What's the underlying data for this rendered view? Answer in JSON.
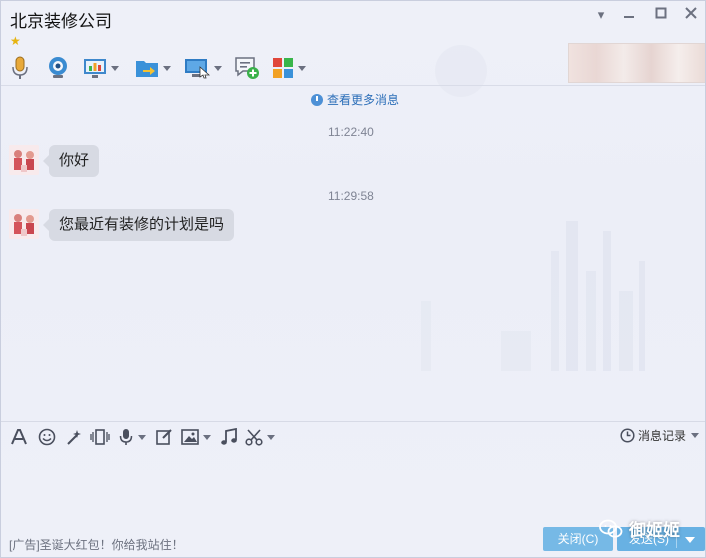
{
  "window": {
    "title": "北京装修公司",
    "favorite_icon": "star-icon",
    "controls": [
      "dropdown-icon",
      "minimize-icon",
      "maximize-icon",
      "close-icon"
    ]
  },
  "toolbar": {
    "items": [
      {
        "name": "voice-call",
        "icon": "microphone-icon"
      },
      {
        "name": "video-call",
        "icon": "webcam-icon"
      },
      {
        "name": "remote-desktop",
        "icon": "presentation-icon",
        "dropdown": true
      },
      {
        "name": "send-file",
        "icon": "folder-send-icon",
        "dropdown": true
      },
      {
        "name": "screen-share",
        "icon": "screen-share-icon",
        "dropdown": true
      },
      {
        "name": "create-discussion",
        "icon": "add-chat-icon"
      },
      {
        "name": "apps",
        "icon": "apps-grid-icon",
        "dropdown": true
      }
    ]
  },
  "chat": {
    "more_messages": "查看更多消息",
    "messages": [
      {
        "time": "11:22:40",
        "text": "你好"
      },
      {
        "time": "11:29:58",
        "text": "您最近有装修的计划是吗"
      }
    ]
  },
  "input_toolbar": {
    "icons": [
      "font-icon",
      "emoji-icon",
      "magic-wand-icon",
      "shake-icon",
      "voice-message-icon",
      "edit-icon",
      "image-icon",
      "music-icon",
      "screenshot-scissors-icon"
    ],
    "history_label": "消息记录"
  },
  "footer": {
    "ad_text": "[广告]圣诞大红包！你给我站住！",
    "close_label": "关闭(C)",
    "send_label": "发送(S)"
  },
  "watermark": {
    "text": "御姬姬"
  },
  "colors": {
    "accent": "#68b1e3",
    "bubble": "#d7dae3",
    "link": "#2d6fb9"
  }
}
